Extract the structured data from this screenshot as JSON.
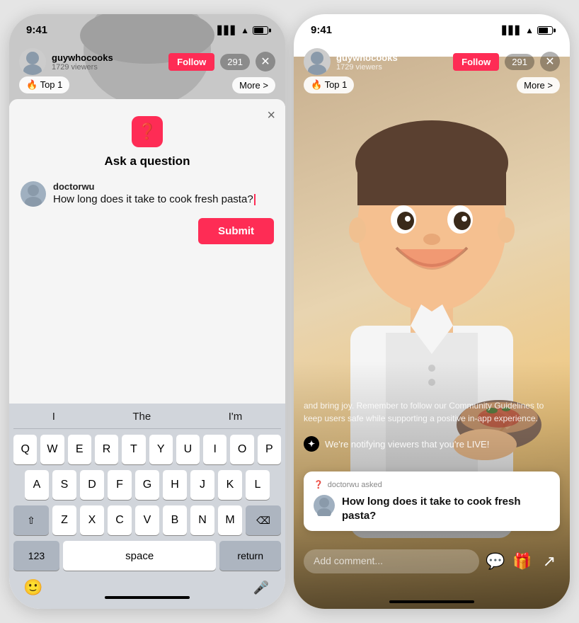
{
  "left_phone": {
    "status_time": "9:41",
    "username": "guywhocooks",
    "viewers": "1729 viewers",
    "follow_label": "Follow",
    "viewer_count": "291",
    "top_badge": "🔥 Top 1",
    "more_label": "More >",
    "modal": {
      "title": "Ask a question",
      "close_label": "×",
      "asker_username": "doctorwu",
      "question_text": "How long does it take to cook fresh pasta?",
      "submit_label": "Submit"
    },
    "keyboard": {
      "predictive": [
        "I",
        "The",
        "I'm"
      ],
      "row1": [
        "Q",
        "W",
        "E",
        "R",
        "T",
        "Y",
        "U",
        "I",
        "O",
        "P"
      ],
      "row2": [
        "A",
        "S",
        "D",
        "F",
        "G",
        "H",
        "J",
        "K",
        "L"
      ],
      "row3": [
        "Z",
        "X",
        "C",
        "V",
        "B",
        "N",
        "M"
      ],
      "num_label": "123",
      "space_label": "space",
      "return_label": "return"
    }
  },
  "right_phone": {
    "status_time": "9:41",
    "username": "guywhocooks",
    "viewers": "1729 viewers",
    "follow_label": "Follow",
    "viewer_count": "291",
    "top_badge": "🔥 Top 1",
    "more_label": "More >",
    "notification_text": "and bring joy. Remember to follow our Community Guidelines to keep users safe while supporting a positive in-app experience.",
    "live_note": "We're notifying viewers that you're LIVE!",
    "question_card": {
      "asked_label": "doctorwu asked",
      "question": "How long does it take to cook fresh pasta?"
    },
    "comment_placeholder": "Add comment...",
    "comment_icon": "💬",
    "gift_icon": "🎁",
    "share_icon": "↗"
  }
}
